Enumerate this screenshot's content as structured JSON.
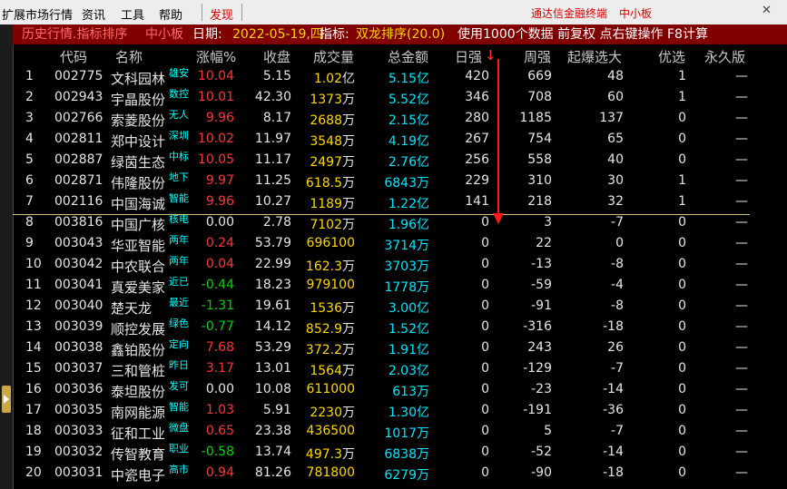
{
  "menu": {
    "items": [
      "扩展市场行情",
      "资讯",
      "工具",
      "帮助"
    ],
    "active": "发现",
    "right_title": "通达信金融终端",
    "right_sub": "中小板"
  },
  "titlebar": {
    "prefix": "历史行情.指标排序",
    "board": "中小板",
    "date_label": "日期:",
    "date": "2022-05-19,四",
    "indicator_label": "指标:",
    "indicator": "双龙排序(20.0)",
    "note": "使用1000个数据 前复权 点右键操作 F8计算"
  },
  "columns": [
    "代码",
    "名称",
    "涨幅%",
    "收盘",
    "成交量",
    "总金额",
    "日强",
    "周强",
    "起爆选大",
    "优选",
    "永久版"
  ],
  "sort_indicator": "↓",
  "rows": [
    {
      "idx": "1",
      "code": "002775",
      "name": "文科园林",
      "tag": "雄安",
      "pct": "10.04",
      "dir": "up",
      "close": "5.15",
      "vol": "1.02",
      "vu": "亿",
      "amt": "5.15",
      "au": "亿",
      "rq": "420",
      "zq": "669",
      "qb": "48",
      "yx": "1",
      "yj": "—"
    },
    {
      "idx": "2",
      "code": "002943",
      "name": "宇晶股份",
      "tag": "数控",
      "pct": "10.01",
      "dir": "up",
      "close": "42.30",
      "vol": "1373",
      "vu": "万",
      "amt": "5.52",
      "au": "亿",
      "rq": "346",
      "zq": "708",
      "qb": "60",
      "yx": "1",
      "yj": "—"
    },
    {
      "idx": "3",
      "code": "002766",
      "name": "索菱股份",
      "tag": "无人",
      "pct": "9.96",
      "dir": "up",
      "close": "8.17",
      "vol": "2688",
      "vu": "万",
      "amt": "2.15",
      "au": "亿",
      "rq": "280",
      "zq": "1185",
      "qb": "137",
      "yx": "0",
      "yj": "—"
    },
    {
      "idx": "4",
      "code": "002811",
      "name": "郑中设计",
      "tag": "深圳",
      "pct": "10.02",
      "dir": "up",
      "close": "11.97",
      "vol": "3548",
      "vu": "万",
      "amt": "4.19",
      "au": "亿",
      "rq": "267",
      "zq": "754",
      "qb": "65",
      "yx": "0",
      "yj": "—"
    },
    {
      "idx": "5",
      "code": "002887",
      "name": "绿茵生态",
      "tag": "中标",
      "pct": "10.05",
      "dir": "up",
      "close": "11.17",
      "vol": "2497",
      "vu": "万",
      "amt": "2.76",
      "au": "亿",
      "rq": "256",
      "zq": "558",
      "qb": "40",
      "yx": "0",
      "yj": "—"
    },
    {
      "idx": "6",
      "code": "002871",
      "name": "伟隆股份",
      "tag": "地下",
      "pct": "9.97",
      "dir": "up",
      "close": "11.25",
      "vol": "618.5",
      "vu": "万",
      "amt": "6843",
      "au": "万",
      "rq": "229",
      "zq": "310",
      "qb": "30",
      "yx": "1",
      "yj": "—"
    },
    {
      "idx": "7",
      "code": "002116",
      "name": "中国海诚",
      "tag": "智能",
      "pct": "9.96",
      "dir": "up",
      "close": "10.27",
      "vol": "1189",
      "vu": "万",
      "amt": "1.22",
      "au": "亿",
      "rq": "141",
      "zq": "218",
      "qb": "32",
      "yx": "1",
      "yj": "—"
    },
    {
      "idx": "8",
      "code": "003816",
      "name": "中国广核",
      "tag": "核电",
      "pct": "0.00",
      "dir": "flat",
      "close": "2.78",
      "vol": "7102",
      "vu": "万",
      "amt": "1.96",
      "au": "亿",
      "rq": "0",
      "zq": "3",
      "qb": "-7",
      "yx": "0",
      "yj": "—"
    },
    {
      "idx": "9",
      "code": "003043",
      "name": "华亚智能",
      "tag": "两年",
      "pct": "0.24",
      "dir": "up",
      "close": "53.79",
      "vol": "696100",
      "vu": "",
      "amt": "3714",
      "au": "万",
      "rq": "0",
      "zq": "22",
      "qb": "0",
      "yx": "0",
      "yj": "—"
    },
    {
      "idx": "10",
      "code": "003042",
      "name": "中农联合",
      "tag": "两年",
      "pct": "0.04",
      "dir": "up",
      "close": "22.99",
      "vol": "162.3",
      "vu": "万",
      "amt": "3703",
      "au": "万",
      "rq": "0",
      "zq": "-13",
      "qb": "-8",
      "yx": "0",
      "yj": "—"
    },
    {
      "idx": "11",
      "code": "003041",
      "name": "真爱美家",
      "tag": "近已",
      "pct": "-0.44",
      "dir": "down",
      "close": "18.23",
      "vol": "979100",
      "vu": "",
      "amt": "1778",
      "au": "万",
      "rq": "0",
      "zq": "-59",
      "qb": "-4",
      "yx": "0",
      "yj": "—"
    },
    {
      "idx": "12",
      "code": "003040",
      "name": "楚天龙",
      "tag": "最近",
      "pct": "-1.31",
      "dir": "down",
      "close": "19.61",
      "vol": "1536",
      "vu": "万",
      "amt": "3.00",
      "au": "亿",
      "rq": "0",
      "zq": "-91",
      "qb": "-8",
      "yx": "0",
      "yj": "—"
    },
    {
      "idx": "13",
      "code": "003039",
      "name": "顺控发展",
      "tag": "绿色",
      "pct": "-0.77",
      "dir": "down",
      "close": "14.12",
      "vol": "852.9",
      "vu": "万",
      "amt": "1.52",
      "au": "亿",
      "rq": "0",
      "zq": "-316",
      "qb": "-18",
      "yx": "0",
      "yj": "—"
    },
    {
      "idx": "14",
      "code": "003038",
      "name": "鑫铂股份",
      "tag": "定向",
      "pct": "7.68",
      "dir": "up",
      "close": "53.29",
      "vol": "372.2",
      "vu": "万",
      "amt": "1.91",
      "au": "亿",
      "rq": "0",
      "zq": "243",
      "qb": "26",
      "yx": "0",
      "yj": "—"
    },
    {
      "idx": "15",
      "code": "003037",
      "name": "三和管桩",
      "tag": "昨日",
      "pct": "3.17",
      "dir": "up",
      "close": "13.01",
      "vol": "1564",
      "vu": "万",
      "amt": "2.03",
      "au": "亿",
      "rq": "0",
      "zq": "-129",
      "qb": "-7",
      "yx": "0",
      "yj": "—"
    },
    {
      "idx": "16",
      "code": "003036",
      "name": "泰坦股份",
      "tag": "发可",
      "pct": "0.00",
      "dir": "flat",
      "close": "10.08",
      "vol": "611000",
      "vu": "",
      "amt": "613",
      "au": "万",
      "rq": "0",
      "zq": "-23",
      "qb": "-14",
      "yx": "0",
      "yj": "—"
    },
    {
      "idx": "17",
      "code": "003035",
      "name": "南网能源",
      "tag": "智能",
      "pct": "1.03",
      "dir": "up",
      "close": "5.91",
      "vol": "2230",
      "vu": "万",
      "amt": "1.30",
      "au": "亿",
      "rq": "0",
      "zq": "-191",
      "qb": "-36",
      "yx": "0",
      "yj": "—"
    },
    {
      "idx": "18",
      "code": "003033",
      "name": "征和工业",
      "tag": "微盘",
      "pct": "0.65",
      "dir": "up",
      "close": "23.38",
      "vol": "436500",
      "vu": "",
      "amt": "1017",
      "au": "万",
      "rq": "0",
      "zq": "5",
      "qb": "-7",
      "yx": "0",
      "yj": "—"
    },
    {
      "idx": "19",
      "code": "003032",
      "name": "传智教育",
      "tag": "职业",
      "pct": "-0.58",
      "dir": "down",
      "close": "13.74",
      "vol": "497.3",
      "vu": "万",
      "amt": "6838",
      "au": "万",
      "rq": "0",
      "zq": "-52",
      "qb": "-14",
      "yx": "0",
      "yj": "—"
    },
    {
      "idx": "20",
      "code": "003031",
      "name": "中瓷电子",
      "tag": "高市",
      "pct": "0.94",
      "dir": "up",
      "close": "81.26",
      "vol": "781800",
      "vu": "",
      "amt": "6279",
      "au": "万",
      "rq": "0",
      "zq": "-90",
      "qb": "-18",
      "yx": "0",
      "yj": "—"
    }
  ]
}
